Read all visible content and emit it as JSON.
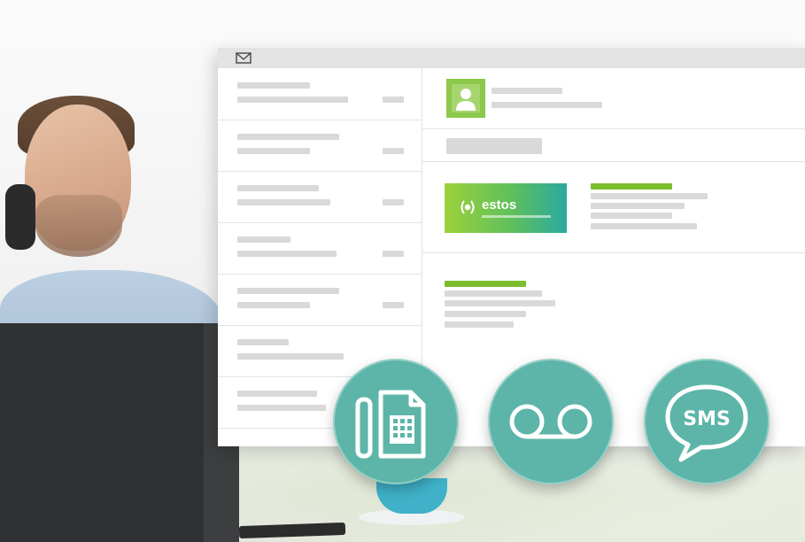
{
  "window": {
    "title_icon": "mail-icon"
  },
  "message_list": {
    "item_count": 7
  },
  "detail": {
    "contact_avatar": "person-icon",
    "company_logo": {
      "text": "estos",
      "colors": [
        "#9bd13a",
        "#2aa9a1"
      ]
    }
  },
  "features": [
    {
      "name": "fax",
      "icon": "fax-icon"
    },
    {
      "name": "voicemail",
      "icon": "voicemail-icon"
    },
    {
      "name": "sms",
      "icon": "sms-icon",
      "label": "SMS"
    }
  ],
  "colors": {
    "accent": "#5cb5a8",
    "green": "#7cbd2d",
    "placeholder": "#d9d9d9"
  }
}
